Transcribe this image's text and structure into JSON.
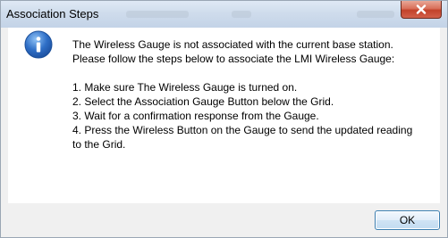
{
  "dialog": {
    "title": "Association Steps",
    "icon": "info-icon",
    "message_intro": [
      "The Wireless Gauge is not associated with the current base station.",
      "Please follow the steps below to associate the LMI Wireless Gauge:"
    ],
    "steps": [
      "1. Make sure The Wireless Gauge is turned on.",
      "2. Select the Association Gauge Button below the Grid.",
      "3. Wait for a confirmation response from the Gauge.",
      "4. Press the Wireless Button on the Gauge to send the updated reading",
      "to the Grid."
    ],
    "ok_label": "OK"
  },
  "colors": {
    "close_button": "#c2422a",
    "info_icon": "#2f6fc7",
    "ok_border": "#3c7fb1"
  }
}
